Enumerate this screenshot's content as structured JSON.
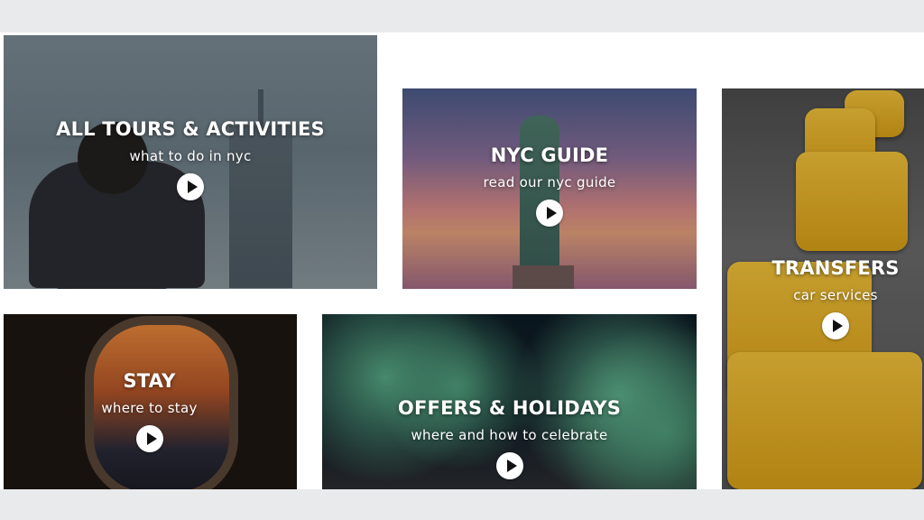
{
  "tiles": {
    "tours": {
      "title": "ALL TOURS & ACTIVITIES",
      "subtitle": "what to do in nyc"
    },
    "guide": {
      "title": "NYC GUIDE",
      "subtitle": "read our nyc guide"
    },
    "transfers": {
      "title": "TRANSFERS",
      "subtitle": "car services"
    },
    "stay": {
      "title": "STAY",
      "subtitle": "where to stay"
    },
    "offers": {
      "title": "OFFERS & HOLIDAYS",
      "subtitle": "where and how to celebrate"
    }
  },
  "icons": {
    "play": "play-icon"
  },
  "colors": {
    "caption_text": "#ffffff",
    "play_button": "#ffffff",
    "taxi_yellow": "#f2c23a",
    "page_bg": "#ffffff",
    "backdrop": "#e9eaec"
  }
}
